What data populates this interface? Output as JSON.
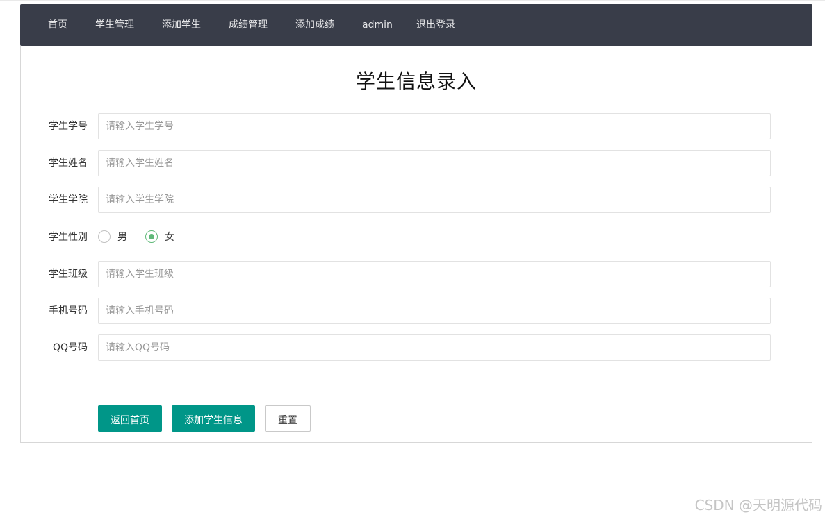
{
  "nav": {
    "items": [
      {
        "label": "首页"
      },
      {
        "label": "学生管理"
      },
      {
        "label": "添加学生"
      },
      {
        "label": "成绩管理"
      },
      {
        "label": "添加成绩"
      },
      {
        "label": "admin"
      },
      {
        "label": "退出登录"
      }
    ]
  },
  "form": {
    "title": "学生信息录入",
    "fields": {
      "student_id": {
        "label": "学生学号",
        "placeholder": "请输入学生学号",
        "value": ""
      },
      "name": {
        "label": "学生姓名",
        "placeholder": "请输入学生姓名",
        "value": ""
      },
      "college": {
        "label": "学生学院",
        "placeholder": "请输入学生学院",
        "value": ""
      },
      "gender": {
        "label": "学生性别",
        "options": [
          "男",
          "女"
        ],
        "selected": "女"
      },
      "class": {
        "label": "学生班级",
        "placeholder": "请输入学生班级",
        "value": ""
      },
      "phone": {
        "label": "手机号码",
        "placeholder": "请输入手机号码",
        "value": ""
      },
      "qq": {
        "label": "QQ号码",
        "placeholder": "请输入QQ号码",
        "value": ""
      }
    },
    "buttons": {
      "back": "返回首页",
      "submit": "添加学生信息",
      "reset": "重置"
    }
  },
  "colors": {
    "nav_bg": "#393d49",
    "primary": "#009688",
    "radio_checked": "#5fb878"
  },
  "watermark": "CSDN @天明源代码"
}
